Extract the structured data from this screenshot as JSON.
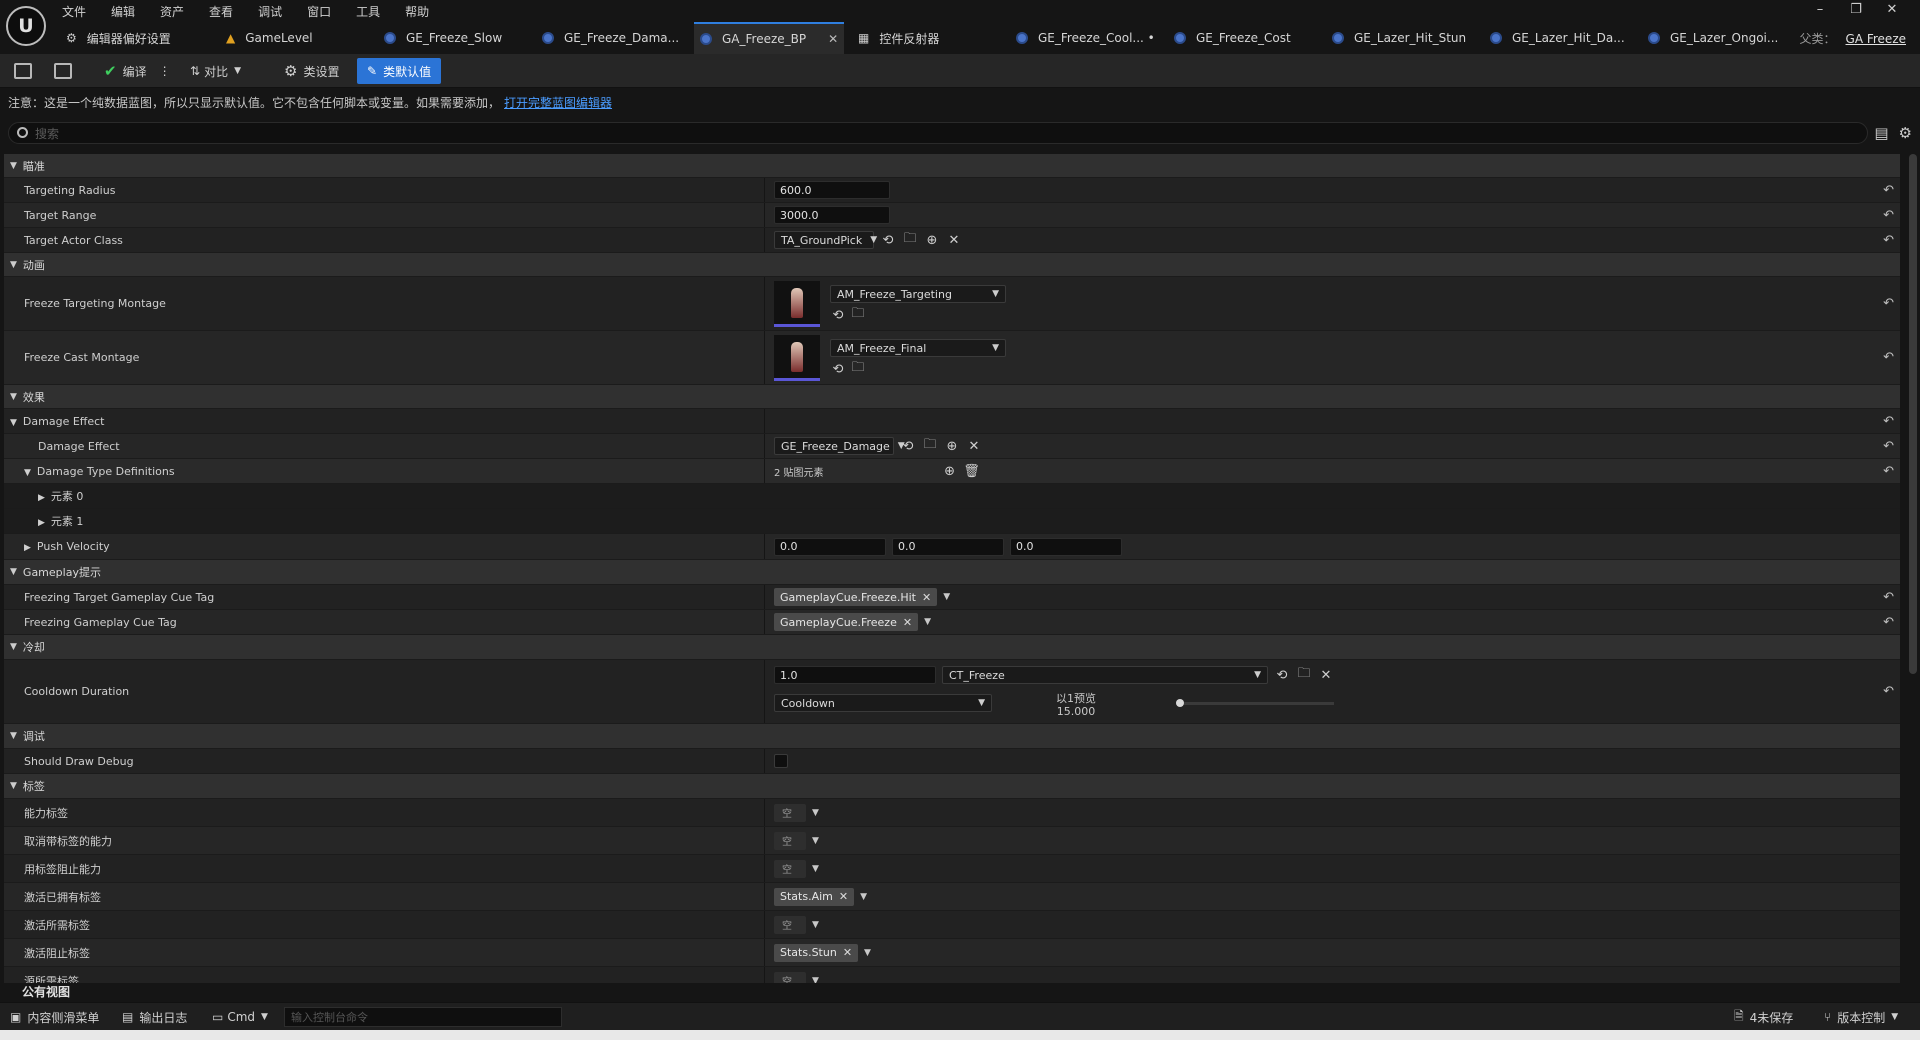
{
  "app": {
    "logo": "U"
  },
  "menu": [
    "文件",
    "编辑",
    "资产",
    "查看",
    "调试",
    "窗口",
    "工具",
    "帮助"
  ],
  "tabs": [
    {
      "label": "编辑器偏好设置",
      "icon": "settings-sliders-icon"
    },
    {
      "label": "GameLevel",
      "icon": "level-icon"
    },
    {
      "label": "GE_Freeze_Slow",
      "icon": "blueprint-icon"
    },
    {
      "label": "GE_Freeze_Dama...",
      "icon": "blueprint-icon"
    },
    {
      "label": "GA_Freeze_BP",
      "icon": "blueprint-icon",
      "active": true
    },
    {
      "label": "控件反射器",
      "icon": "widget-reflector-icon"
    },
    {
      "label": "GE_Freeze_Cool... •",
      "icon": "blueprint-icon"
    },
    {
      "label": "GE_Freeze_Cost",
      "icon": "blueprint-icon"
    },
    {
      "label": "GE_Lazer_Hit_Stun",
      "icon": "blueprint-icon"
    },
    {
      "label": "GE_Lazer_Hit_Da...",
      "icon": "blueprint-icon"
    },
    {
      "label": "GE_Lazer_Ongoi...",
      "icon": "blueprint-icon"
    }
  ],
  "parent_class": {
    "label": "父类：",
    "value": "GA Freeze"
  },
  "toolbar": {
    "compile": "编译",
    "diff": "对比",
    "class_settings": "类设置",
    "class_defaults": "类默认值"
  },
  "notice": {
    "text": "注意：这是一个纯数据蓝图，所以只显示默认值。它不包含任何脚本或变量。如果需要添加，",
    "link": "打开完整蓝图编辑器"
  },
  "search": {
    "placeholder": "搜索"
  },
  "details": {
    "cat_targeting": "瞄准",
    "targeting_radius": {
      "label": "Targeting Radius",
      "value": "600.0"
    },
    "target_range": {
      "label": "Target Range",
      "value": "3000.0"
    },
    "target_actor_class": {
      "label": "Target Actor Class",
      "value": "TA_GroundPick"
    },
    "cat_animation": "动画",
    "freeze_targeting_montage": {
      "label": "Freeze Targeting Montage",
      "value": "AM_Freeze_Targeting"
    },
    "freeze_cast_montage": {
      "label": "Freeze Cast Montage",
      "value": "AM_Freeze_Final"
    },
    "cat_effects": "效果",
    "damage_effect_group": "Damage Effect",
    "damage_effect": {
      "label": "Damage Effect",
      "value": "GE_Freeze_Damage"
    },
    "damage_type_defs": {
      "label": "Damage Type Definitions",
      "value": "2 贴图元素"
    },
    "element0": "元素 0",
    "element1": "元素 1",
    "push_velocity": {
      "label": "Push Velocity",
      "x": "0.0",
      "y": "0.0",
      "z": "0.0"
    },
    "cat_cue": "Gameplay提示",
    "freezing_target_cue": {
      "label": "Freezing Target Gameplay Cue Tag",
      "value": "GameplayCue.Freeze.Hit"
    },
    "freezing_cue": {
      "label": "Freezing Gameplay Cue Tag",
      "value": "GameplayCue.Freeze"
    },
    "cat_cooldown": "冷却",
    "cooldown_duration": {
      "label": "Cooldown Duration",
      "value": "1.0",
      "curve_table": "CT_Freeze",
      "curve_row": "Cooldown",
      "preview_label": "以1预览",
      "preview_value": "15.000"
    },
    "cat_debug": "调试",
    "should_draw_debug": {
      "label": "Should Draw Debug"
    },
    "cat_tags": "标签",
    "tags": [
      {
        "label": "能力标签",
        "value": "空",
        "empty": true
      },
      {
        "label": "取消带标签的能力",
        "value": "空",
        "empty": true
      },
      {
        "label": "用标签阻止能力",
        "value": "空",
        "empty": true
      },
      {
        "label": "激活已拥有标签",
        "value": "Stats.Aim",
        "empty": false
      },
      {
        "label": "激活所需标签",
        "value": "空",
        "empty": true
      },
      {
        "label": "激活阻止标签",
        "value": "Stats.Stun",
        "empty": false
      },
      {
        "label": "源所需标签",
        "value": "空",
        "empty": true
      }
    ]
  },
  "public_view": "公有视图",
  "statusbar": {
    "content_drawer": "内容侧滑菜单",
    "output_log": "输出日志",
    "cmd": "Cmd",
    "cmd_placeholder": "输入控制台命令",
    "unsaved": "4未保存",
    "source_control": "版本控制"
  }
}
